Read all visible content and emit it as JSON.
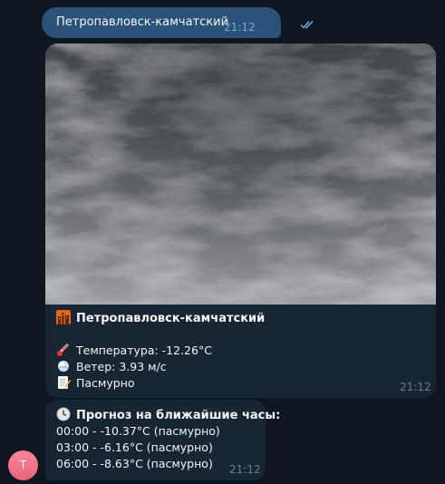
{
  "outgoing": {
    "text": "Петропавловск-камчатский",
    "time": "21:12",
    "status_icon": "double-check-icon"
  },
  "weather_card": {
    "photo_alt": "cloudy-sky-photo",
    "title": "Петропавловск-камчатский",
    "temperature": "Температура: -12.26°C",
    "wind": "Ветер: 3.93 м/с",
    "condition": "Пасмурно",
    "time": "21:12"
  },
  "forecast": {
    "heading": "Прогноз на ближайшие часы:",
    "rows": [
      "00:00 - -10.37°C (пасмурно)",
      "03:00 - -6.16°C (пасмурно)",
      "06:00 - -8.63°C (пасмурно)"
    ],
    "time": "21:12"
  },
  "avatar": {
    "letter": "T"
  },
  "colors": {
    "background": "#0e1621",
    "outgoing_bubble": "#2b5278",
    "incoming_bubble": "#182533",
    "avatar": "#e5667b"
  }
}
